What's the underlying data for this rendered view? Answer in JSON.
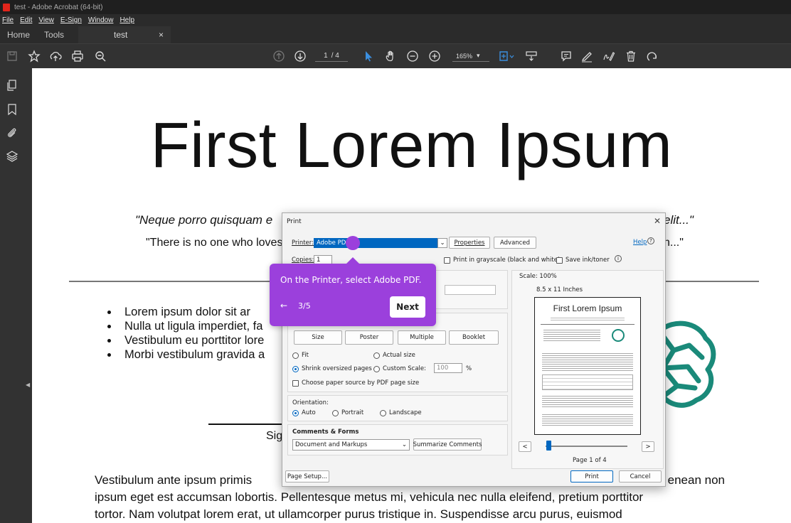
{
  "window": {
    "title": "test - Adobe Acrobat (64-bit)"
  },
  "menu": [
    "File",
    "Edit",
    "View",
    "E-Sign",
    "Window",
    "Help"
  ],
  "tabs": {
    "home": "Home",
    "tools": "Tools",
    "doc": "test",
    "close": "×"
  },
  "toolbar": {
    "page_current": "1",
    "page_total": "/ 4",
    "zoom": "165%"
  },
  "document": {
    "title": "First Lorem Ipsum",
    "quote1_left": "\"Neque porro quisquam e",
    "quote1_right": "elit...\"",
    "quote2_left": "\"There is no one who loves",
    "quote2_right": "n...\"",
    "bullets": [
      "Lorem ipsum dolor sit ar",
      "Nulla ut ligula imperdiet, fa",
      "Vestibulum eu porttitor lore",
      "Morbi vestibulum gravida a"
    ],
    "signature_partial": "Sig",
    "para_line1_left": "Vestibulum ante ipsum primis",
    "para_line1_right": "enean non",
    "para_line2": "ipsum eget est accumsan lobortis. Pellentesque metus mi, vehicula nec nulla eleifend, pretium porttitor",
    "para_line3": "tortor. Nam volutpat lorem erat, ut ullamcorper purus tristique in. Suspendisse arcu purus, euismod"
  },
  "print_dialog": {
    "title": "Print",
    "printer_label": "Printer:",
    "printer_value": "Adobe PDF",
    "properties": "Properties",
    "advanced": "Advanced",
    "help": "Help",
    "copies_label": "Copies:",
    "copies_value": "1",
    "grayscale": "Print in grayscale (black and white)",
    "save_ink": "Save ink/toner",
    "size_tabs": [
      "Size",
      "Poster",
      "Multiple",
      "Booklet"
    ],
    "fit": "Fit",
    "actual_size": "Actual size",
    "shrink": "Shrink oversized pages",
    "custom_scale": "Custom Scale:",
    "custom_scale_value": "100",
    "percent": "%",
    "paper_source": "Choose paper source by PDF page size",
    "orientation_label": "Orientation:",
    "orient_auto": "Auto",
    "orient_portrait": "Portrait",
    "orient_landscape": "Landscape",
    "comments_label": "Comments & Forms",
    "comments_value": "Document and Markups",
    "summarize": "Summarize Comments",
    "scale_label": "Scale: 100%",
    "paper_size": "8.5 x 11 Inches",
    "preview_title": "First Lorem Ipsum",
    "preview_prev": "<",
    "preview_next": ">",
    "page_of": "Page 1 of 4",
    "page_setup": "Page Setup...",
    "print": "Print",
    "cancel": "Cancel"
  },
  "coachmark": {
    "text": "On the Printer, select Adobe PDF.",
    "back": "←",
    "step": "3/5",
    "next": "Next"
  },
  "colors": {
    "accent": "#9b40dc",
    "brain": "#1a8a7a",
    "selection": "#0067c0"
  }
}
